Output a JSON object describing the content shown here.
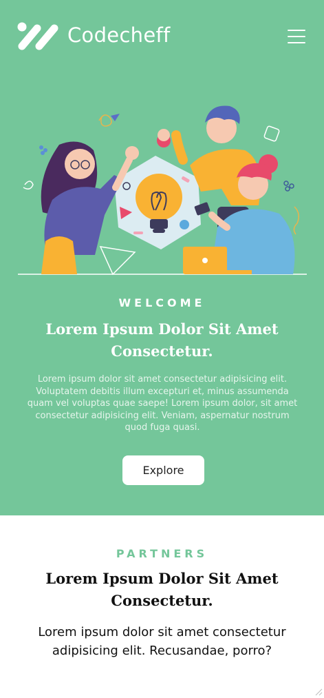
{
  "header": {
    "brand": "Codecheff",
    "logo_icon": "codecheff-logo-icon",
    "menu_icon": "hamburger-menu-icon"
  },
  "hero": {
    "eyebrow": "WELCOME",
    "title": "Lorem Ipsum Dolor Sit Amet Consectetur.",
    "text": "Lorem ipsum dolor sit amet consectetur adipisicing elit. Voluptatem debitis illum excepturi et, minus assumenda quam vel voluptas quae saepe! Lorem ipsum dolor, sit amet consectetur adipisicing elit. Veniam, aspernatur nostrum quod fuga quasi.",
    "button_label": "Explore"
  },
  "partners": {
    "eyebrow": "PARTNERS",
    "title": "Lorem Ipsum Dolor Sit Amet Consectetur.",
    "text": "Lorem ipsum dolor sit amet consectetur adipisicing elit. Recusandae, porro?"
  },
  "colors": {
    "brand_green": "#74c69a",
    "white": "#ffffff",
    "text_dark": "#111111"
  }
}
